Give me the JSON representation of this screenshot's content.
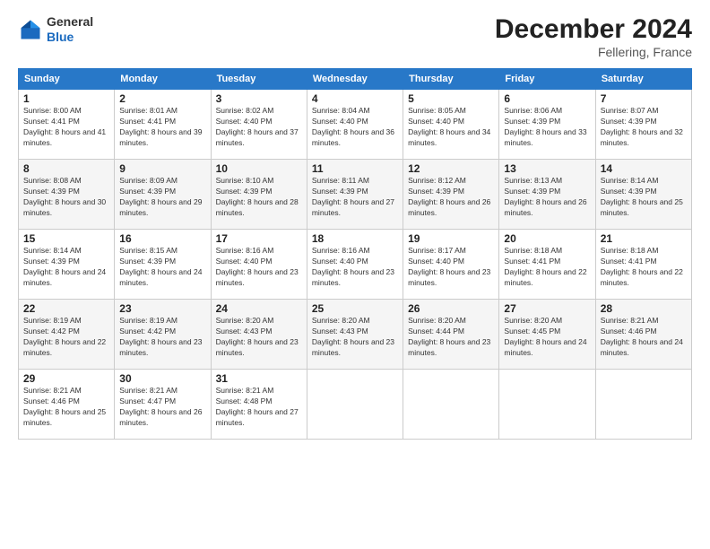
{
  "logo": {
    "general": "General",
    "blue": "Blue"
  },
  "header": {
    "title": "December 2024",
    "subtitle": "Fellering, France"
  },
  "weekdays": [
    "Sunday",
    "Monday",
    "Tuesday",
    "Wednesday",
    "Thursday",
    "Friday",
    "Saturday"
  ],
  "weeks": [
    [
      {
        "day": "1",
        "sunrise": "8:00 AM",
        "sunset": "4:41 PM",
        "daylight": "8 hours and 41 minutes."
      },
      {
        "day": "2",
        "sunrise": "8:01 AM",
        "sunset": "4:41 PM",
        "daylight": "8 hours and 39 minutes."
      },
      {
        "day": "3",
        "sunrise": "8:02 AM",
        "sunset": "4:40 PM",
        "daylight": "8 hours and 37 minutes."
      },
      {
        "day": "4",
        "sunrise": "8:04 AM",
        "sunset": "4:40 PM",
        "daylight": "8 hours and 36 minutes."
      },
      {
        "day": "5",
        "sunrise": "8:05 AM",
        "sunset": "4:40 PM",
        "daylight": "8 hours and 34 minutes."
      },
      {
        "day": "6",
        "sunrise": "8:06 AM",
        "sunset": "4:39 PM",
        "daylight": "8 hours and 33 minutes."
      },
      {
        "day": "7",
        "sunrise": "8:07 AM",
        "sunset": "4:39 PM",
        "daylight": "8 hours and 32 minutes."
      }
    ],
    [
      {
        "day": "8",
        "sunrise": "8:08 AM",
        "sunset": "4:39 PM",
        "daylight": "8 hours and 30 minutes."
      },
      {
        "day": "9",
        "sunrise": "8:09 AM",
        "sunset": "4:39 PM",
        "daylight": "8 hours and 29 minutes."
      },
      {
        "day": "10",
        "sunrise": "8:10 AM",
        "sunset": "4:39 PM",
        "daylight": "8 hours and 28 minutes."
      },
      {
        "day": "11",
        "sunrise": "8:11 AM",
        "sunset": "4:39 PM",
        "daylight": "8 hours and 27 minutes."
      },
      {
        "day": "12",
        "sunrise": "8:12 AM",
        "sunset": "4:39 PM",
        "daylight": "8 hours and 26 minutes."
      },
      {
        "day": "13",
        "sunrise": "8:13 AM",
        "sunset": "4:39 PM",
        "daylight": "8 hours and 26 minutes."
      },
      {
        "day": "14",
        "sunrise": "8:14 AM",
        "sunset": "4:39 PM",
        "daylight": "8 hours and 25 minutes."
      }
    ],
    [
      {
        "day": "15",
        "sunrise": "8:14 AM",
        "sunset": "4:39 PM",
        "daylight": "8 hours and 24 minutes."
      },
      {
        "day": "16",
        "sunrise": "8:15 AM",
        "sunset": "4:39 PM",
        "daylight": "8 hours and 24 minutes."
      },
      {
        "day": "17",
        "sunrise": "8:16 AM",
        "sunset": "4:40 PM",
        "daylight": "8 hours and 23 minutes."
      },
      {
        "day": "18",
        "sunrise": "8:16 AM",
        "sunset": "4:40 PM",
        "daylight": "8 hours and 23 minutes."
      },
      {
        "day": "19",
        "sunrise": "8:17 AM",
        "sunset": "4:40 PM",
        "daylight": "8 hours and 23 minutes."
      },
      {
        "day": "20",
        "sunrise": "8:18 AM",
        "sunset": "4:41 PM",
        "daylight": "8 hours and 22 minutes."
      },
      {
        "day": "21",
        "sunrise": "8:18 AM",
        "sunset": "4:41 PM",
        "daylight": "8 hours and 22 minutes."
      }
    ],
    [
      {
        "day": "22",
        "sunrise": "8:19 AM",
        "sunset": "4:42 PM",
        "daylight": "8 hours and 22 minutes."
      },
      {
        "day": "23",
        "sunrise": "8:19 AM",
        "sunset": "4:42 PM",
        "daylight": "8 hours and 23 minutes."
      },
      {
        "day": "24",
        "sunrise": "8:20 AM",
        "sunset": "4:43 PM",
        "daylight": "8 hours and 23 minutes."
      },
      {
        "day": "25",
        "sunrise": "8:20 AM",
        "sunset": "4:43 PM",
        "daylight": "8 hours and 23 minutes."
      },
      {
        "day": "26",
        "sunrise": "8:20 AM",
        "sunset": "4:44 PM",
        "daylight": "8 hours and 23 minutes."
      },
      {
        "day": "27",
        "sunrise": "8:20 AM",
        "sunset": "4:45 PM",
        "daylight": "8 hours and 24 minutes."
      },
      {
        "day": "28",
        "sunrise": "8:21 AM",
        "sunset": "4:46 PM",
        "daylight": "8 hours and 24 minutes."
      }
    ],
    [
      {
        "day": "29",
        "sunrise": "8:21 AM",
        "sunset": "4:46 PM",
        "daylight": "8 hours and 25 minutes."
      },
      {
        "day": "30",
        "sunrise": "8:21 AM",
        "sunset": "4:47 PM",
        "daylight": "8 hours and 26 minutes."
      },
      {
        "day": "31",
        "sunrise": "8:21 AM",
        "sunset": "4:48 PM",
        "daylight": "8 hours and 27 minutes."
      },
      null,
      null,
      null,
      null
    ]
  ],
  "labels": {
    "sunrise": "Sunrise:",
    "sunset": "Sunset:",
    "daylight": "Daylight:"
  }
}
